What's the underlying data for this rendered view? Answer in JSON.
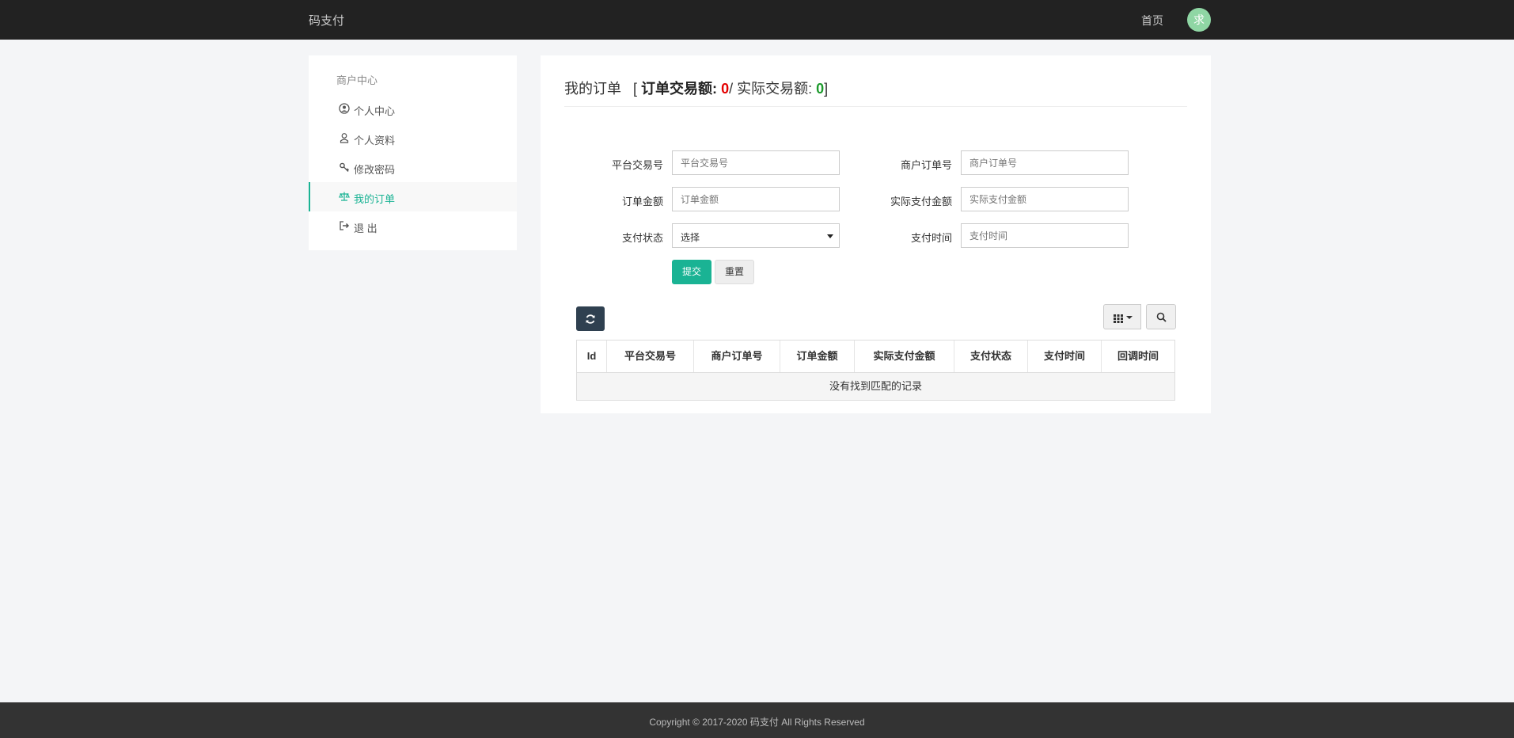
{
  "header": {
    "brand": "码支付",
    "nav_home": "首页",
    "avatar_text": "求",
    "avatar_color": "#8fd6a4"
  },
  "sidebar": {
    "title": "商户中心",
    "items": [
      {
        "label": "个人中心",
        "icon": "user-circle-icon",
        "active": false
      },
      {
        "label": "个人资料",
        "icon": "user-icon",
        "active": false
      },
      {
        "label": "修改密码",
        "icon": "key-icon",
        "active": false
      },
      {
        "label": "我的订单",
        "icon": "scale-icon",
        "active": true
      },
      {
        "label": "退 出",
        "icon": "sign-out-icon",
        "active": false
      }
    ]
  },
  "page": {
    "title": "我的订单",
    "open_bracket": "[",
    "order_amount_label": "订单交易额:",
    "order_amount_value": "0",
    "separator": "/",
    "actual_amount_label": "实际交易额:",
    "actual_amount_value": "0",
    "close_bracket": "]"
  },
  "form": {
    "fields": [
      {
        "label": "平台交易号",
        "placeholder": "平台交易号"
      },
      {
        "label": "商户订单号",
        "placeholder": "商户订单号"
      },
      {
        "label": "订单金额",
        "placeholder": "订单金额"
      },
      {
        "label": "实际支付金额",
        "placeholder": "实际支付金额"
      },
      {
        "label": "支付状态",
        "value": "选择"
      },
      {
        "label": "支付时间",
        "placeholder": "支付时间"
      }
    ],
    "submit_label": "提交",
    "reset_label": "重置"
  },
  "table": {
    "columns": [
      "Id",
      "平台交易号",
      "商户订单号",
      "订单金额",
      "实际支付金额",
      "支付状态",
      "支付时间",
      "回调时间"
    ],
    "empty_text": "没有找到匹配的记录"
  },
  "footer": {
    "copyright": "Copyright © 2017-2020 码支付 All Rights Reserved"
  },
  "colors": {
    "accent": "#1ab394",
    "topbar": "#222222",
    "red_value": "#e40000",
    "green_value": "#1c9a2c"
  }
}
